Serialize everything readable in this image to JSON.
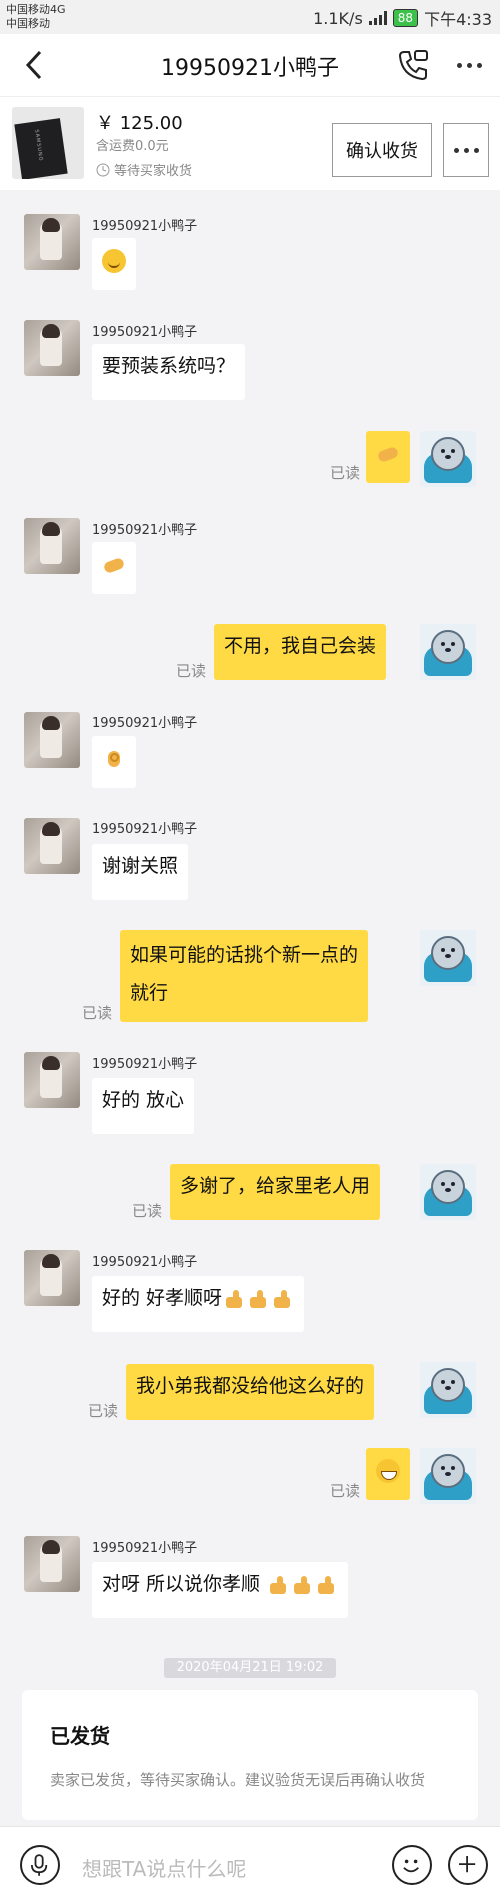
{
  "status_bar": {
    "carrier_1": "中国移动4G",
    "carrier_2": "中国移动",
    "net_speed": "1.1K/s",
    "battery": "88",
    "time": "下午4:33"
  },
  "header": {
    "title": "19950921小鸭子"
  },
  "order": {
    "price": "￥ 125.00",
    "shipping": "含运费0.0元",
    "status": "等待买家收货",
    "confirm_label": "确认收货",
    "product_brand": "SAMSUNG"
  },
  "messages": [
    {
      "side": "in",
      "sender": "19950921小鸭子",
      "text": "",
      "emoji": "smile"
    },
    {
      "side": "in",
      "sender": "19950921小鸭子",
      "text": "要预装系统吗？"
    },
    {
      "side": "out",
      "text": "",
      "emoji": "handshake",
      "read": "已读"
    },
    {
      "side": "in",
      "sender": "19950921小鸭子",
      "text": "",
      "emoji": "handshake"
    },
    {
      "side": "out",
      "text": "不用，我自己会装",
      "read": "已读"
    },
    {
      "side": "in",
      "sender": "19950921小鸭子",
      "text": "",
      "emoji": "ok"
    },
    {
      "side": "in",
      "sender": "19950921小鸭子",
      "text": "谢谢关照"
    },
    {
      "side": "out",
      "text_line1": "如果可能的话挑个新一点的",
      "text_line2": "就行",
      "read": "已读"
    },
    {
      "side": "in",
      "sender": "19950921小鸭子",
      "text": "好的 放心"
    },
    {
      "side": "out",
      "text": "多谢了，给家里老人用",
      "read": "已读"
    },
    {
      "side": "in",
      "sender": "19950921小鸭子",
      "text": "好的 好孝顺呀"
    },
    {
      "side": "out",
      "text": "我小弟我都没给他这么好的",
      "read": "已读"
    },
    {
      "side": "out",
      "text": "",
      "emoji": "grin",
      "read": "已读"
    },
    {
      "side": "in",
      "sender": "19950921小鸭子",
      "text": "对呀 所以说你孝顺"
    }
  ],
  "timestamp": "2020年04月21日 19:02",
  "shipped_card": {
    "title": "已发货",
    "desc": "卖家已发货，等待买家确认。建议验货无误后再确认收货"
  },
  "input": {
    "placeholder": "想跟TA说点什么呢"
  },
  "colors": {
    "outgoing_bubble": "#ffda44",
    "incoming_bubble": "#ffffff",
    "background": "#f3f3f6"
  }
}
